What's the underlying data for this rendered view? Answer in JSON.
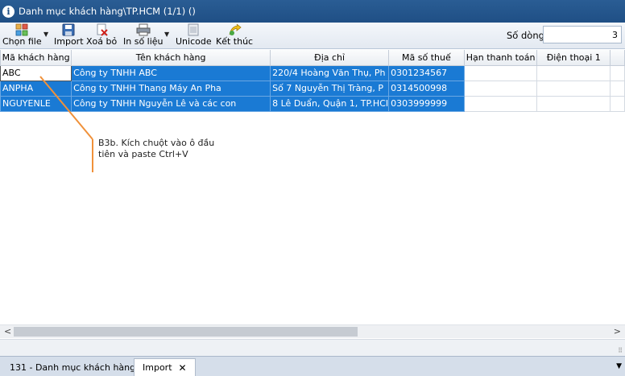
{
  "window": {
    "title": "Danh mục khách hàng\\TP.HCM (1/1) ()"
  },
  "toolbar": {
    "choose_file": "Chọn file",
    "import": "Import",
    "delete": "Xoá bỏ",
    "print": "In số liệu",
    "unicode": "Unicode",
    "exit": "Kết thúc",
    "rows_label": "Số dòng",
    "rows_value": "3"
  },
  "grid": {
    "columns": [
      "Mã khách hàng",
      "Tên khách hàng",
      "Địa chỉ",
      "Mã số thuế",
      "Hạn thanh toán",
      "Điện thoại 1"
    ],
    "rows": [
      [
        "ABC",
        "Công ty TNHH ABC",
        "220/4 Hoàng Văn Thụ, Ph",
        "0301234567",
        "",
        ""
      ],
      [
        "ANPHA",
        "Công ty TNHH Thang Máy An Pha",
        "Số 7 Nguyễn Thị Tràng, P",
        "0314500998",
        "",
        ""
      ],
      [
        "NGUYENLE",
        "Công ty TNHH Nguyễn Lê và các con",
        "8 Lê Duẩn, Quận 1, TP.HCI",
        "0303999999",
        "",
        ""
      ]
    ]
  },
  "annotation": {
    "line1": "B3b. Kích chuột vào ô đầu",
    "line2": "tiên và paste Ctrl+V",
    "color": "#f0913a"
  },
  "tabs": [
    {
      "label": "131 - Danh mục khách hàng"
    },
    {
      "label": "Import"
    }
  ],
  "colors": {
    "title_bar": "#1f4f85",
    "selection": "#1a7ad4"
  }
}
